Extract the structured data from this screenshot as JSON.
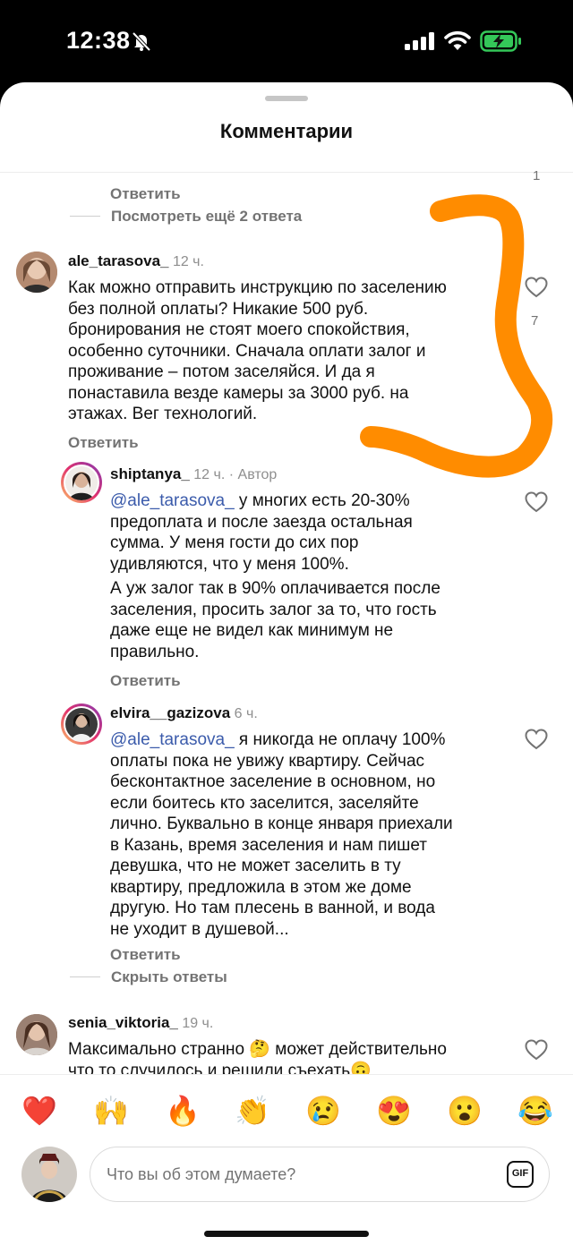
{
  "status_bar": {
    "time": "12:38",
    "battery_color": "#34c759"
  },
  "sheet": {
    "title": "Комментарии"
  },
  "top_thread": {
    "reply_label": "Ответить",
    "view_more": "Посмотреть ещё 2 ответа",
    "like_count": "1"
  },
  "comments": [
    {
      "username": "ale_tarasova_",
      "time": "12 ч.",
      "text": "Как можно отправить инструкцию по заселению\nбез полной оплаты? Никакие 500 руб.\nбронирования не стоят моего спокойствия,\nособенно суточники. Сначала оплати залог и\nпроживание – потом заселяйся. И да я\nпонаставила везде камеры за 3000 руб. на\nэтажах. Вег технологий.",
      "reply_label": "Ответить",
      "like_count": "7"
    },
    {
      "username": "shiptanya_",
      "time": "12 ч.",
      "badge": "Автор",
      "mention": "@ale_tarasova_",
      "text": " у многих есть 20-30%\nпредоплата и после заезда остальная\nсумма. У меня гости до сих пор\nудивляются, что у меня 100%.",
      "text2": "А уж залог так в 90% оплачивается после\nзаселения, просить  залог за то, что гость\nдаже еще не видел как минимум не\nправильно.",
      "reply_label": "Ответить"
    },
    {
      "username": "elvira__gazizova",
      "time": "6 ч.",
      "mention": "@ale_tarasova_",
      "text": " я никогда не оплачу 100%\nоплаты пока не увижу квартиру. Сейчас\nбесконтактное заселение в основном, но\nесли боитесь кто заселится, заселяйте\nлично.  Буквально в конце января приехали\nв Казань, время заселения и нам пишет\nдевушка, что не может заселить в ту\nквартиру, предложила в этом же доме\nдругую. Но там плесень в ванной, и вода\nне уходит в душевой...",
      "reply_label": "Ответить",
      "hide_replies": "Скрыть ответы"
    },
    {
      "username": "senia_viktoria_",
      "time": "19 ч.",
      "text": "Максимально странно 🤔 может действительно\nчто то случилось и решили съехать🙃"
    }
  ],
  "composer": {
    "emojis": [
      "❤️",
      "🙌",
      "🔥",
      "👏",
      "😢",
      "😍",
      "😮",
      "😂"
    ],
    "placeholder": "Что вы об этом думаете?",
    "gif_label": "GIF"
  },
  "annotation_color": "#ff8c00"
}
